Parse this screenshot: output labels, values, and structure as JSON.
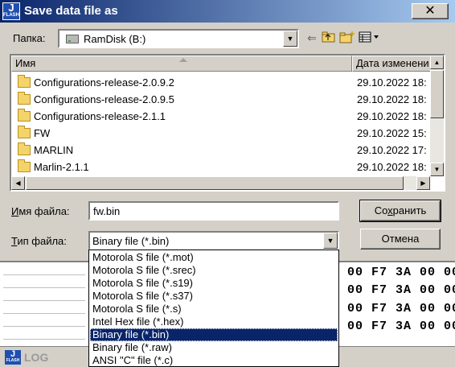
{
  "window": {
    "title": "Save data file as",
    "logo_text": "J",
    "logo_sub": "FLASH",
    "close_label": "✕"
  },
  "lookin": {
    "label": "Папка:",
    "value": "RamDisk (B:)"
  },
  "columns": {
    "name": "Имя",
    "date": "Дата изменени"
  },
  "files": [
    {
      "name": "Configurations-release-2.0.9.2",
      "date": "29.10.2022 18:"
    },
    {
      "name": "Configurations-release-2.0.9.5",
      "date": "29.10.2022 18:"
    },
    {
      "name": "Configurations-release-2.1.1",
      "date": "29.10.2022 18:"
    },
    {
      "name": "FW",
      "date": "29.10.2022 15:"
    },
    {
      "name": "MARLIN",
      "date": "29.10.2022 17:"
    },
    {
      "name": "Marlin-2.1.1",
      "date": "29.10.2022 18:"
    }
  ],
  "filename": {
    "label_pre": "",
    "label_u": "И",
    "label_post": "мя файла:",
    "value": "fw.bin"
  },
  "filetype": {
    "label_pre": "",
    "label_u": "Т",
    "label_post": "ип файла:",
    "value": "Binary file (*.bin)"
  },
  "buttons": {
    "save_pre": "Со",
    "save_u": "х",
    "save_post": "ранить",
    "cancel": "Отмена"
  },
  "filetype_options": [
    {
      "label": "Motorola S file (*.mot)",
      "selected": false
    },
    {
      "label": "Motorola S file (*.srec)",
      "selected": false
    },
    {
      "label": "Motorola S file (*.s19)",
      "selected": false
    },
    {
      "label": "Motorola S file (*.s37)",
      "selected": false
    },
    {
      "label": "Motorola S file (*.s)",
      "selected": false
    },
    {
      "label": "Intel Hex file (*.hex)",
      "selected": false
    },
    {
      "label": "Binary file (*.bin)",
      "selected": true
    },
    {
      "label": "Binary file (*.raw)",
      "selected": false
    },
    {
      "label": "ANSI \"C\" file (*.c)",
      "selected": false
    }
  ],
  "background": {
    "hex_lines": [
      "00 F7 3A 00 00",
      "00 F7 3A 00 00",
      "00 F7 3A 00 00",
      "00 F7 3A 00 00"
    ],
    "log_label": "LOG"
  }
}
